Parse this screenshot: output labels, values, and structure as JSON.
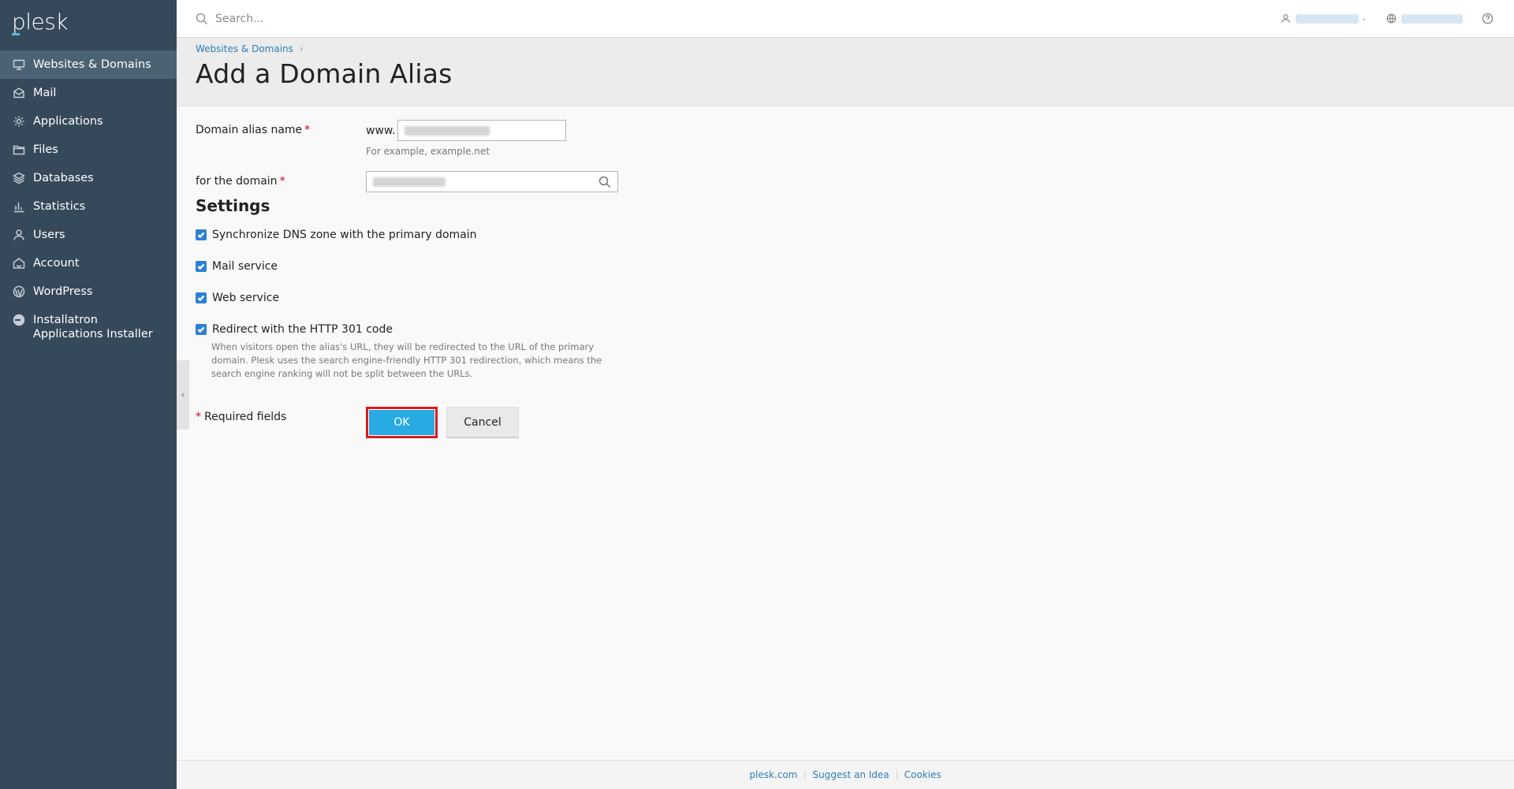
{
  "brand": {
    "logo_text": "plesk"
  },
  "sidebar": {
    "items": [
      {
        "label": "Websites & Domains",
        "icon": "monitor-icon",
        "active": true
      },
      {
        "label": "Mail",
        "icon": "envelope-icon",
        "active": false
      },
      {
        "label": "Applications",
        "icon": "gear-icon",
        "active": false
      },
      {
        "label": "Files",
        "icon": "folder-icon",
        "active": false
      },
      {
        "label": "Databases",
        "icon": "layers-icon",
        "active": false
      },
      {
        "label": "Statistics",
        "icon": "bar-chart-icon",
        "active": false
      },
      {
        "label": "Users",
        "icon": "user-icon",
        "active": false
      },
      {
        "label": "Account",
        "icon": "account-icon",
        "active": false
      },
      {
        "label": "WordPress",
        "icon": "wordpress-icon",
        "active": false
      },
      {
        "label": "Installatron Applications Installer",
        "icon": "installatron-icon",
        "active": false
      }
    ]
  },
  "topbar": {
    "search_placeholder": "Search..."
  },
  "header": {
    "breadcrumb": "Websites & Domains",
    "title": "Add a Domain Alias"
  },
  "form": {
    "alias_label": "Domain alias name",
    "required_mark": "*",
    "www_prefix": "www.",
    "alias_hint": "For example, example.net",
    "domain_label": "for the domain",
    "settings_title": "Settings",
    "checkboxes": [
      {
        "label": "Synchronize DNS zone with the primary domain",
        "checked": true
      },
      {
        "label": "Mail service",
        "checked": true
      },
      {
        "label": "Web service",
        "checked": true
      },
      {
        "label": "Redirect with the HTTP 301 code",
        "checked": true
      }
    ],
    "redirect_description": "When visitors open the alias's URL, they will be redirected to the URL of the primary domain. Plesk uses the search engine-friendly HTTP 301 redirection, which means the search engine ranking will not be split between the URLs.",
    "required_note": "Required fields",
    "ok_label": "OK",
    "cancel_label": "Cancel"
  },
  "footer": {
    "links": [
      "plesk.com",
      "Suggest an Idea",
      "Cookies"
    ]
  },
  "colors": {
    "sidebar_bg": "#35495a",
    "sidebar_active": "#4b6274",
    "primary_button": "#28aae2",
    "highlight_border": "#e01919",
    "link": "#2f7eb5",
    "required": "#d0021b"
  }
}
